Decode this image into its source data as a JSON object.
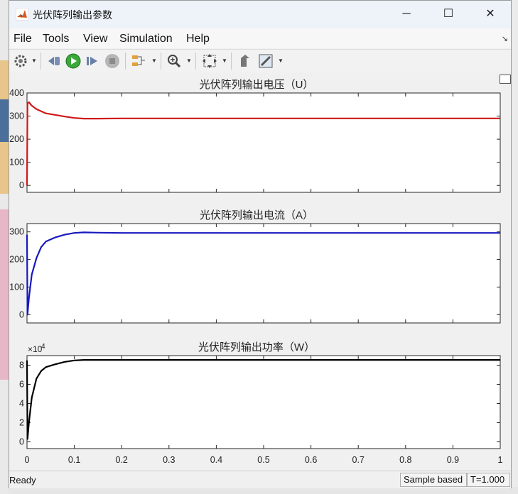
{
  "window": {
    "title": "光伏阵列输出参数",
    "minimize_label": "─",
    "maximize_label": "☐",
    "close_label": "✕"
  },
  "menu": {
    "items": [
      {
        "label": "File"
      },
      {
        "label": "Tools"
      },
      {
        "label": "View"
      },
      {
        "label": "Simulation"
      },
      {
        "label": "Help"
      }
    ]
  },
  "toolbar": {
    "icons": [
      "settings-icon",
      "step-back-icon",
      "run-icon",
      "step-forward-icon",
      "stop-icon",
      "signal-selector-icon",
      "zoom-icon",
      "fit-view-icon",
      "highlight-icon",
      "style-icon"
    ]
  },
  "status": {
    "ready": "Ready",
    "sample_mode": "Sample based",
    "time": "T=1.000"
  },
  "chart_data": [
    {
      "type": "line",
      "title": "光伏阵列输出电压（U）",
      "ylim": [
        -30,
        400
      ],
      "yticks": [
        0,
        100,
        200,
        300,
        400
      ],
      "xlim": [
        0,
        1
      ],
      "grid": false,
      "color": "#d01818",
      "x": [
        0,
        0.001,
        0.004,
        0.01,
        0.02,
        0.04,
        0.06,
        0.08,
        0.1,
        0.12,
        0.15,
        0.2,
        0.3,
        0.5,
        0.7,
        0.9,
        1.0
      ],
      "series": [
        {
          "values": [
            0,
            355,
            360,
            345,
            330,
            312,
            305,
            298,
            292,
            289,
            289,
            290,
            290,
            290,
            290,
            290,
            290
          ]
        }
      ]
    },
    {
      "type": "line",
      "title": "光伏阵列输出电流（A）",
      "ylim": [
        -30,
        330
      ],
      "yticks": [
        0,
        100,
        200,
        300
      ],
      "xlim": [
        0,
        1
      ],
      "grid": false,
      "color": "#1818c0",
      "x": [
        0,
        0.001,
        0.004,
        0.01,
        0.02,
        0.03,
        0.04,
        0.06,
        0.08,
        0.1,
        0.12,
        0.15,
        0.2,
        0.3,
        0.5,
        0.7,
        0.9,
        1.0
      ],
      "series": [
        {
          "values": [
            290,
            0,
            60,
            145,
            205,
            245,
            265,
            280,
            290,
            296,
            298,
            297,
            296,
            296,
            296,
            296,
            296,
            296
          ]
        }
      ]
    },
    {
      "type": "line",
      "title": "光伏阵列输出功率（W）",
      "ylim": [
        -0.7,
        9.0
      ],
      "yticks": [
        0,
        2,
        4,
        6,
        8
      ],
      "multiplier_base": "×10",
      "multiplier_exp": "4",
      "xlim": [
        0,
        1
      ],
      "xticks": [
        "0",
        "0.1",
        "0.2",
        "0.3",
        "0.4",
        "0.5",
        "0.6",
        "0.7",
        "0.8",
        "0.9",
        "1"
      ],
      "grid": false,
      "color": "#000000",
      "x": [
        0,
        0.001,
        0.004,
        0.01,
        0.02,
        0.03,
        0.04,
        0.06,
        0.08,
        0.1,
        0.12,
        0.15,
        0.2,
        0.3,
        0.5,
        0.7,
        0.9,
        1.0
      ],
      "series": [
        {
          "values": [
            8.5,
            0.3,
            2.0,
            4.6,
            6.6,
            7.4,
            7.8,
            8.1,
            8.35,
            8.5,
            8.55,
            8.55,
            8.55,
            8.55,
            8.55,
            8.55,
            8.55,
            8.55
          ]
        }
      ]
    }
  ]
}
